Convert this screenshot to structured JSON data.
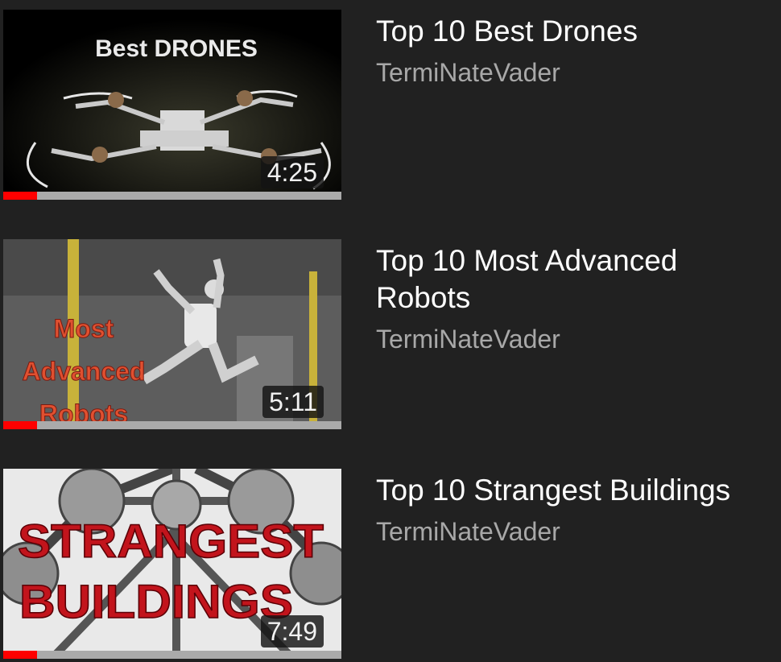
{
  "videos": [
    {
      "title": "Top 10 Best Drones",
      "channel": "TermiNateVader",
      "duration": "4:25",
      "progress_fraction": 0.1,
      "thumbnail_icon": "drone-image",
      "thumbnail_text": [
        "Best DRONES"
      ]
    },
    {
      "title": "Top 10 Most Advanced Robots",
      "channel": "TermiNateVader",
      "duration": "5:11",
      "progress_fraction": 0.1,
      "thumbnail_icon": "robot-image",
      "thumbnail_text": [
        "Most",
        "Advanced",
        "Robots"
      ]
    },
    {
      "title": "Top 10 Strangest Buildings",
      "channel": "TermiNateVader",
      "duration": "7:49",
      "progress_fraction": 0.1,
      "thumbnail_icon": "atomium-image",
      "thumbnail_text": [
        "STRANGEST",
        "BUILDINGS"
      ]
    }
  ],
  "colors": {
    "background": "#212121",
    "title": "#ffffff",
    "channel": "#a8a8a8",
    "progress": "#ff0000",
    "progress_track": "#aaaaaa"
  }
}
